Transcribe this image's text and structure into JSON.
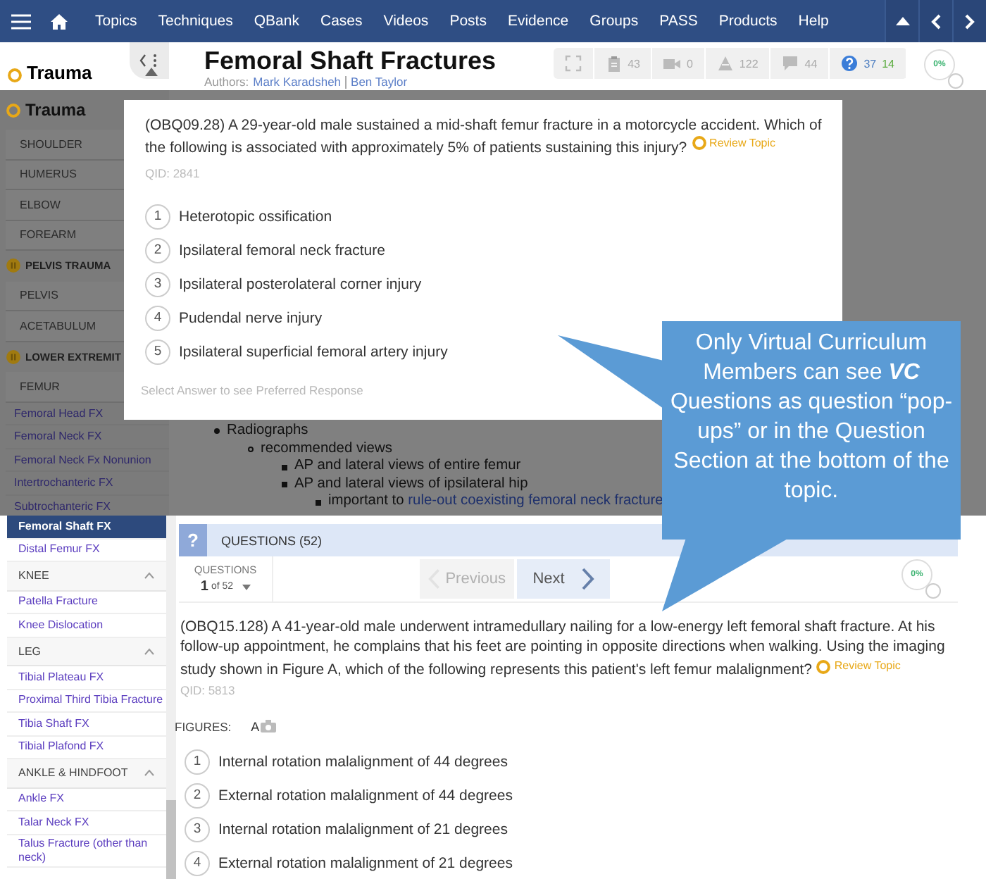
{
  "nav": {
    "items": [
      "Topics",
      "Techniques",
      "QBank",
      "Cases",
      "Videos",
      "Posts",
      "Evidence",
      "Groups",
      "PASS",
      "Products",
      "Help"
    ]
  },
  "sidebar_header": {
    "title": "Trauma"
  },
  "topic": {
    "title": "Femoral Shaft Fractures",
    "authors_label": "Authors:",
    "authors": [
      "Mark Karadsheh",
      "Ben Taylor"
    ]
  },
  "stats": [
    {
      "kind": "fullscreen"
    },
    {
      "kind": "clipboard",
      "count": "43"
    },
    {
      "kind": "video",
      "count": "0"
    },
    {
      "kind": "triangle",
      "count": "122"
    },
    {
      "kind": "comment",
      "count": "44"
    },
    {
      "kind": "question",
      "count": "37",
      "count_secondary": "14"
    }
  ],
  "progress": "0%",
  "sidebar": {
    "title": "Trauma",
    "items": [
      {
        "kind": "category",
        "label": "SHOULDER",
        "selected": false
      },
      {
        "kind": "category",
        "label": "HUMERUS",
        "selected": false
      },
      {
        "kind": "category",
        "label": "ELBOW",
        "selected": false
      },
      {
        "kind": "category",
        "label": "FOREARM",
        "selected": false
      },
      {
        "kind": "section",
        "label": "PELVIS TRAUMA"
      },
      {
        "kind": "category",
        "label": "PELVIS",
        "selected": false
      },
      {
        "kind": "category",
        "label": "ACETABULUM",
        "selected": false
      },
      {
        "kind": "section",
        "label": "LOWER EXTREMIT"
      },
      {
        "kind": "category",
        "label": "FEMUR",
        "selected": false
      },
      {
        "kind": "link",
        "label": "Femoral Head FX",
        "selected": false
      },
      {
        "kind": "link",
        "label": "Femoral Neck FX",
        "selected": false
      },
      {
        "kind": "link",
        "label": "Femoral Neck Fx Nonunion",
        "selected": false
      },
      {
        "kind": "link",
        "label": "Intertrochanteric FX",
        "selected": false
      },
      {
        "kind": "link",
        "label": "Subtrochanteric FX",
        "selected": false
      }
    ]
  },
  "outline": [
    {
      "text": "Radiographs",
      "children": [
        {
          "text": "recommended views",
          "children": [
            {
              "text": "AP and lateral views of entire femur"
            },
            {
              "text": "AP and lateral views of ipsilateral hip",
              "children": [
                {
                  "text": "important to",
                  "link": "rule-out coexisting femoral neck fracture"
                }
              ]
            }
          ]
        }
      ]
    }
  ],
  "popup": {
    "question": "(OBQ09.28) A 29-year-old male sustained a mid-shaft femur fracture in a motorcycle accident. Which of the following is associated with approximately 5% of patients sustaining this injury?",
    "review_link": "Review Topic",
    "qid": "QID: 2841",
    "options": [
      {
        "number": "1",
        "text": "Heterotopic ossification"
      },
      {
        "number": "2",
        "text": "Ipsilateral femoral neck fracture"
      },
      {
        "number": "3",
        "text": "Ipsilateral posterolateral corner injury"
      },
      {
        "number": "4",
        "text": "Pudendal nerve injury"
      },
      {
        "number": "5",
        "text": "Ipsilateral superficial femoral artery injury"
      }
    ],
    "hint": "Select Answer to see Preferred Response"
  },
  "lower_sidebar": {
    "items": [
      {
        "kind": "link",
        "label": "Femoral Shaft FX",
        "selected": true
      },
      {
        "kind": "link",
        "label": "Distal Femur FX",
        "selected": false
      },
      {
        "kind": "group",
        "label": "KNEE",
        "expanded": true
      },
      {
        "kind": "link",
        "label": "Patella Fracture",
        "selected": false
      },
      {
        "kind": "link",
        "label": "Knee Dislocation",
        "selected": false
      },
      {
        "kind": "group",
        "label": "LEG",
        "expanded": true
      },
      {
        "kind": "link",
        "label": "Tibial Plateau FX",
        "selected": false
      },
      {
        "kind": "link",
        "label": "Proximal Third Tibia Fracture",
        "selected": false
      },
      {
        "kind": "link",
        "label": "Tibia Shaft FX",
        "selected": false
      },
      {
        "kind": "link",
        "label": "Tibial Plafond FX",
        "selected": false
      },
      {
        "kind": "group",
        "label": "ANKLE & HINDFOOT",
        "expanded": true
      },
      {
        "kind": "link",
        "label": "Ankle FX",
        "selected": false
      },
      {
        "kind": "link",
        "label": "Talar Neck FX",
        "selected": false
      },
      {
        "kind": "link",
        "label": "Talus Fracture (other than neck)",
        "selected": false
      }
    ]
  },
  "questions": {
    "icon": "?",
    "title": "QUESTIONS (52)",
    "counter_label": "QUESTIONS",
    "current": "1",
    "of_total": "of 52",
    "previous": {
      "label": "Previous",
      "disabled": true
    },
    "next": {
      "label": "Next",
      "disabled": false
    },
    "progress": "0%",
    "question": "(OBQ15.128) A 41-year-old male underwent intramedullary nailing for a low-energy left femoral shaft fracture. At his follow-up appointment, he complains that his feet are pointing in opposite directions when walking. Using the imaging study shown in Figure A, which of the following represents this patient's left femur malalignment?",
    "review_link": "Review Topic",
    "qid": "QID: 5813",
    "figures_label": "FIGURES:",
    "figures": [
      "A"
    ],
    "options": [
      {
        "number": "1",
        "text": "Internal rotation malalignment of 44 degrees"
      },
      {
        "number": "2",
        "text": "External rotation malalignment of 44 degrees"
      },
      {
        "number": "3",
        "text": "Internal rotation malalignment of 21 degrees"
      },
      {
        "number": "4",
        "text": "External rotation malalignment of 21 degrees"
      }
    ]
  },
  "callout": {
    "text": "Only Virtual Curriculum Members can see **VC** Questions as question “pop-ups” or in the Question Section at the bottom of the topic."
  }
}
